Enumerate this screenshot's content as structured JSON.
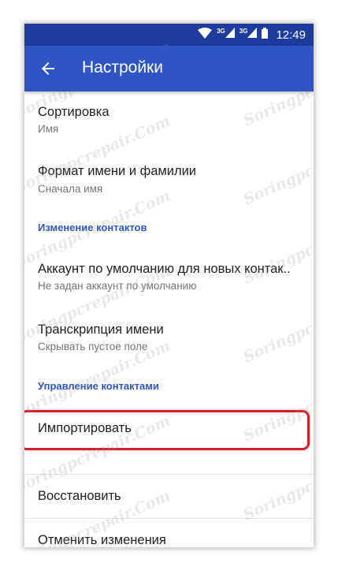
{
  "status_bar": {
    "network_label_1": "3G",
    "network_label_2": "3G",
    "time": "12:49",
    "icons": [
      "wifi-icon",
      "signal-icon",
      "signal-icon",
      "battery-icon"
    ]
  },
  "app_bar": {
    "title": "Настройки",
    "back_icon": "arrow-back-icon"
  },
  "items": {
    "sort": {
      "title": "Сортировка",
      "subtitle": "Имя"
    },
    "name_format": {
      "title": "Формат имени и фамилии",
      "subtitle": "Сначала имя"
    },
    "default_account": {
      "title": "Аккаунт по умолчанию для новых контак..",
      "subtitle": "Не задан аккаунт по умолчанию"
    },
    "transcription": {
      "title": "Транскрипция имени",
      "subtitle": "Скрывать пустое поле"
    },
    "import": {
      "title": "Импортировать"
    },
    "restore": {
      "title": "Восстановить"
    },
    "undo": {
      "title": "Отменить изменения"
    }
  },
  "sections": {
    "edit_contacts": "Изменение контактов",
    "manage_contacts": "Управление контактами"
  },
  "watermark_text": "Soringpcrepair.Com",
  "colors": {
    "status_bar": "#1e3b9e",
    "app_bar": "#2f55c5",
    "section_header": "#2f55c5",
    "highlight": "#d0202a"
  }
}
